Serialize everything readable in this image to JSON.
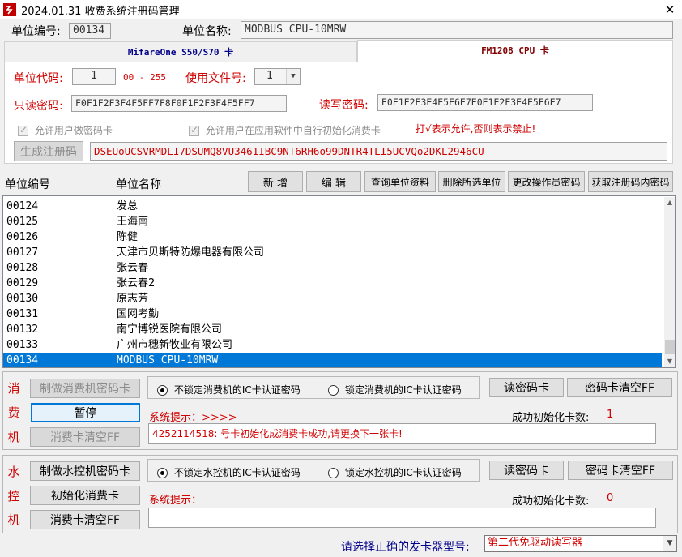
{
  "window": {
    "title": "2024.01.31  收费系统注册码管理",
    "close": "✕"
  },
  "header": {
    "unit_no_label": "单位编号:",
    "unit_no_value": "00134",
    "unit_name_label": "单位名称:",
    "unit_name_value": "MODBUS CPU-10MRW"
  },
  "tabs": [
    {
      "label": "MifareOne S50/S70 卡",
      "active": false
    },
    {
      "label": "FM1208 CPU 卡",
      "active": true
    }
  ],
  "tab_panel": {
    "unit_code_label": "单位代码:",
    "unit_code_value": "1",
    "unit_code_range": "00 - 255",
    "file_no_label": "使用文件号:",
    "file_no_value": "1",
    "readonly_pwd_label": "只读密码:",
    "readonly_pwd_value": "F0F1F2F3F4F5FF7F8F0F1F2F3F4F5FF7",
    "rw_pwd_label": "读写密码:",
    "rw_pwd_value": "E0E1E2E3E4E5E6E7E0E1E2E3E4E5E6E7",
    "allow_make_pwd_card": "允许用户做密码卡",
    "allow_init_card": "允许用户在应用软件中自行初始化消费卡",
    "check_hint": "打√表示允许,否则表示禁止!",
    "gen_code_button": "生成注册码",
    "reg_code_value": "DSEUoUCSVRMDLI7DSUMQ8VU3461IBC9NT6RH6o99DNTR4TLI5UCVQo2DKL2946CU"
  },
  "toolbar": {
    "col_unit_no": "单位编号",
    "col_unit_name": "单位名称",
    "add": "新 增",
    "edit": "编 辑",
    "query": "查询单位资料",
    "delete": "删除所选单位",
    "change_pwd": "更改操作员密码",
    "get_code": "获取注册码内密码"
  },
  "units": [
    {
      "no": "00124",
      "name": "发总"
    },
    {
      "no": "00125",
      "name": "王海南"
    },
    {
      "no": "00126",
      "name": "陈健"
    },
    {
      "no": "00127",
      "name": "天津市贝斯特防爆电器有限公司"
    },
    {
      "no": "00128",
      "name": "张云春"
    },
    {
      "no": "00129",
      "name": "张云春2"
    },
    {
      "no": "00130",
      "name": "原志芳"
    },
    {
      "no": "00131",
      "name": "国网考勤"
    },
    {
      "no": "00132",
      "name": "南宁博锐医院有限公司"
    },
    {
      "no": "00133",
      "name": "广州市穗新牧业有限公司"
    },
    {
      "no": "00134",
      "name": "MODBUS CPU-10MRW",
      "selected": true
    }
  ],
  "consume": {
    "side_label": [
      "消",
      "费",
      "机"
    ],
    "make_pwd_card": "制做消费机密码卡",
    "pause": "暂停",
    "clear_card": "消费卡清空FF",
    "radio_unlock": "不锁定消费机的IC卡认证密码",
    "radio_lock": "锁定消费机的IC卡认证密码",
    "read_pwd_card": "读密码卡",
    "clear_pwd_card": "密码卡清空FF",
    "sys_hint_label": "系统提示：>>>>",
    "success_label": "成功初始化卡数:",
    "success_count": "1",
    "message": "4252114518: 号卡初始化成消费卡成功,请更换下一张卡!"
  },
  "water": {
    "side_label": [
      "水",
      "控",
      "机"
    ],
    "make_pwd_card": "制做水控机密码卡",
    "init_card": "初始化消费卡",
    "clear_card": "消费卡清空FF",
    "radio_unlock": "不锁定水控机的IC卡认证密码",
    "radio_lock": "锁定水控机的IC卡认证密码",
    "read_pwd_card": "读密码卡",
    "clear_pwd_card": "密码卡清空FF",
    "sys_hint_label": "系统提示：",
    "success_label": "成功初始化卡数:",
    "success_count": "0",
    "message": ""
  },
  "footer": {
    "reader_label": "请选择正确的发卡器型号:",
    "reader_value": "第二代免驱动读写器"
  },
  "colors": {
    "accent": "#0078d7",
    "red": "#d00000",
    "navy": "#00008b"
  }
}
